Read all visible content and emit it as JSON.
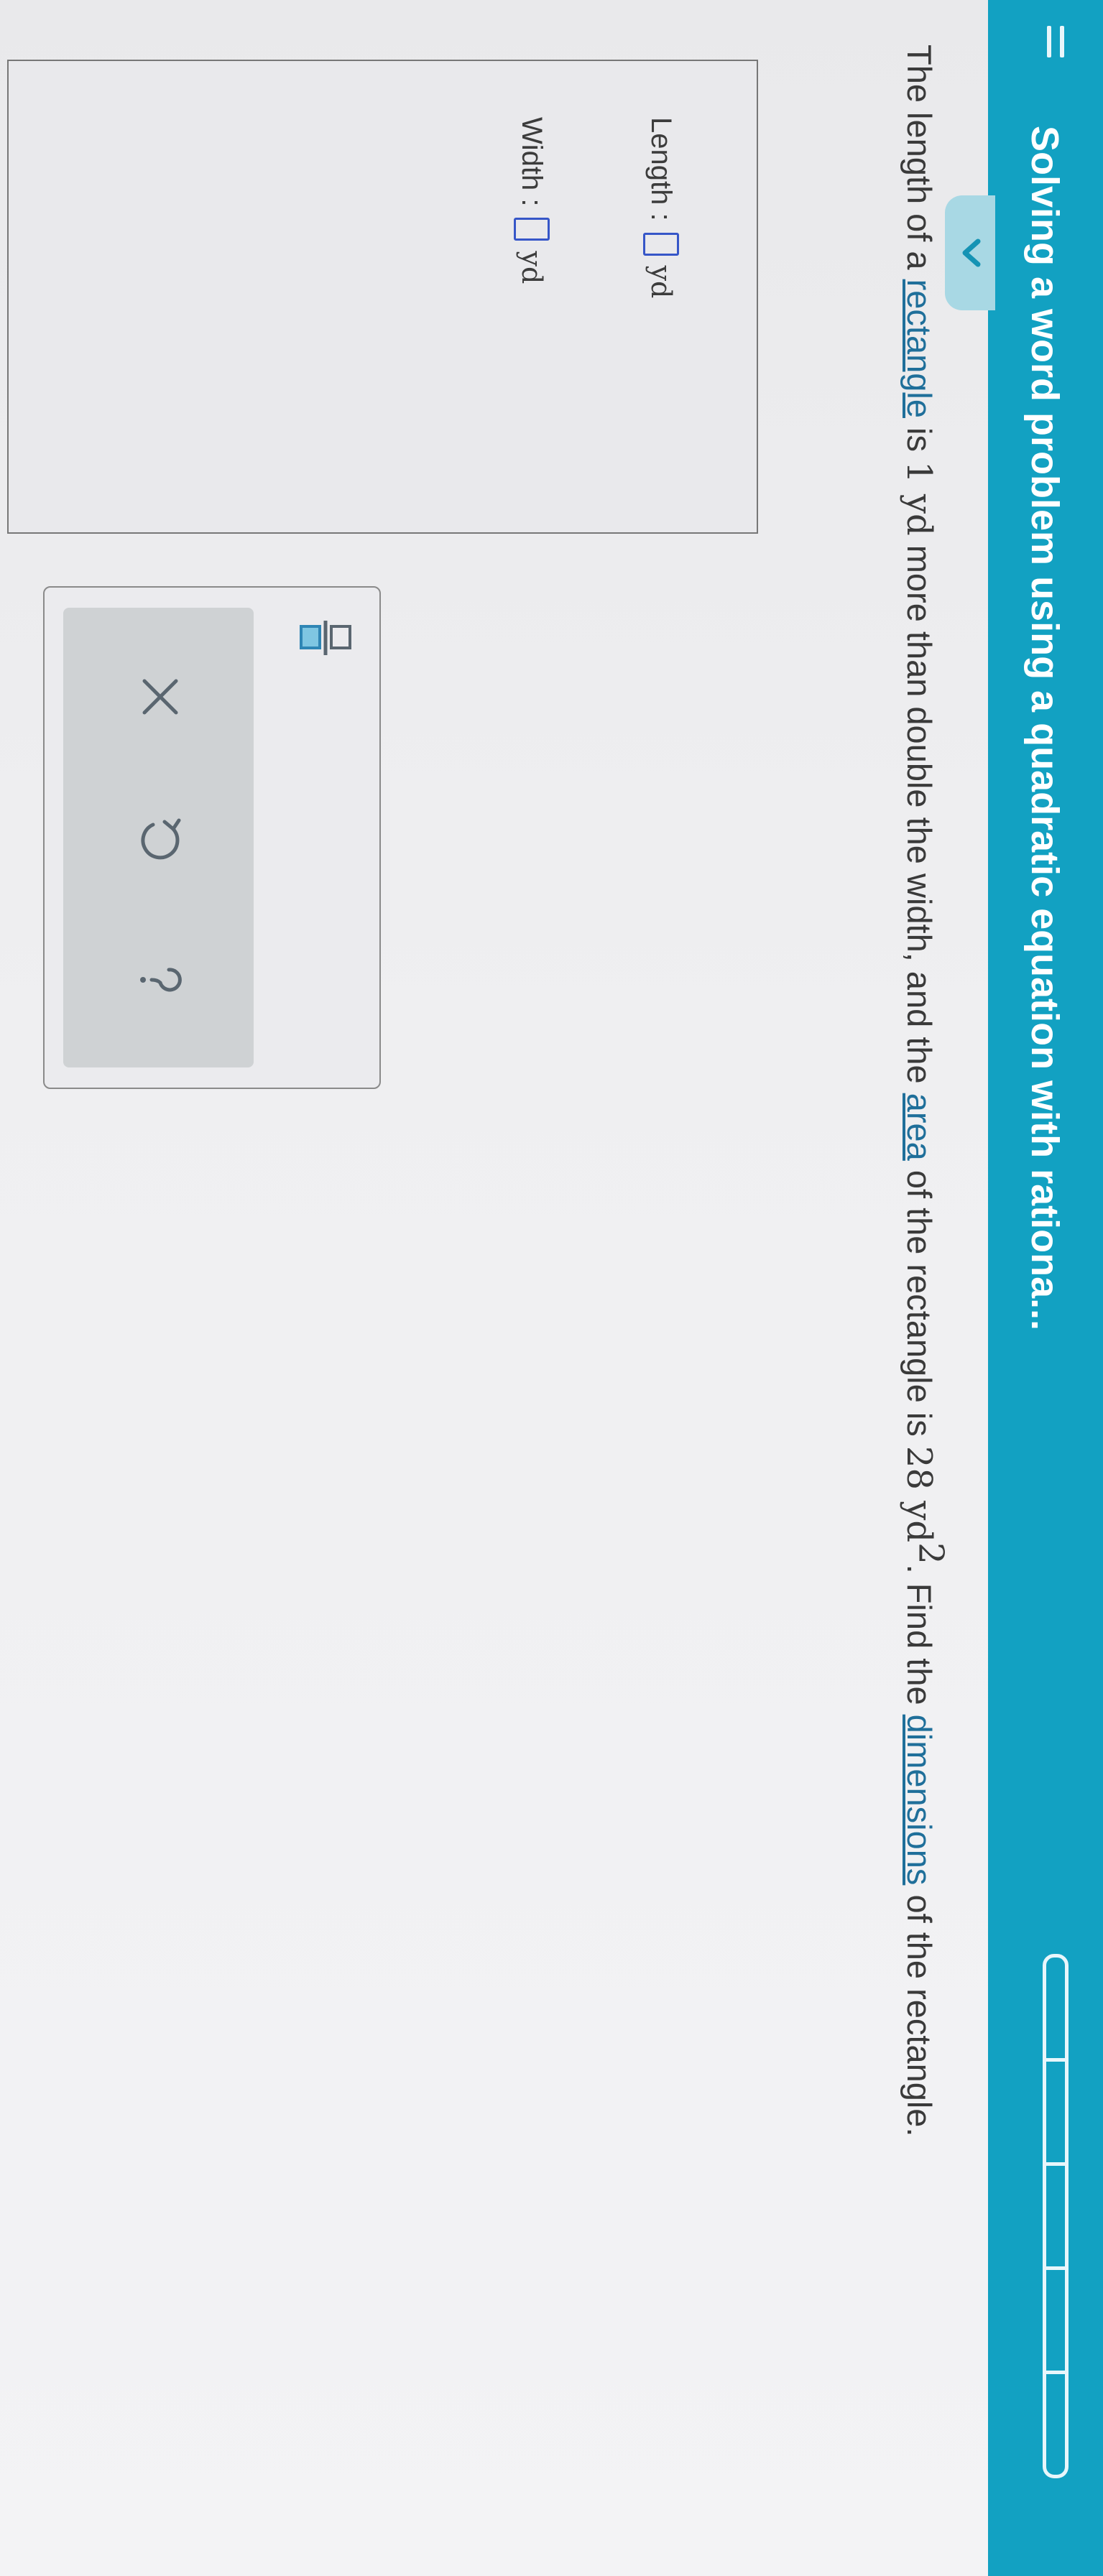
{
  "header": {
    "title": "Solving a word problem using a quadratic equation with rationa...",
    "bg_color": "#12a1c2",
    "progress_segments": 5
  },
  "question": {
    "part1": "The length of a ",
    "link_rectangle": "rectangle",
    "part2": " is ",
    "num1": "1 yd",
    "part3": " more than double the width, and the ",
    "link_area": "area",
    "part4": " of the rectangle is ",
    "num2": "28 yd",
    "sup": "2",
    "part5": ". Find the ",
    "link_dimensions": "dimensions",
    "part6": " of the rectangle."
  },
  "answer": {
    "length_label": "Length :",
    "length_unit": "yd",
    "length_value": "",
    "width_label": "Width :",
    "width_unit": "yd",
    "width_value": ""
  },
  "tools": {
    "fraction_icon": "fraction-icon",
    "clear_icon": "x-icon",
    "undo_icon": "undo-icon",
    "help_icon": "question-icon",
    "clear_symbol": "×",
    "help_symbol": "?"
  },
  "colors": {
    "link": "#1f6f9a",
    "input_border": "#3656c8",
    "action_bar": "#cfd2d4"
  }
}
